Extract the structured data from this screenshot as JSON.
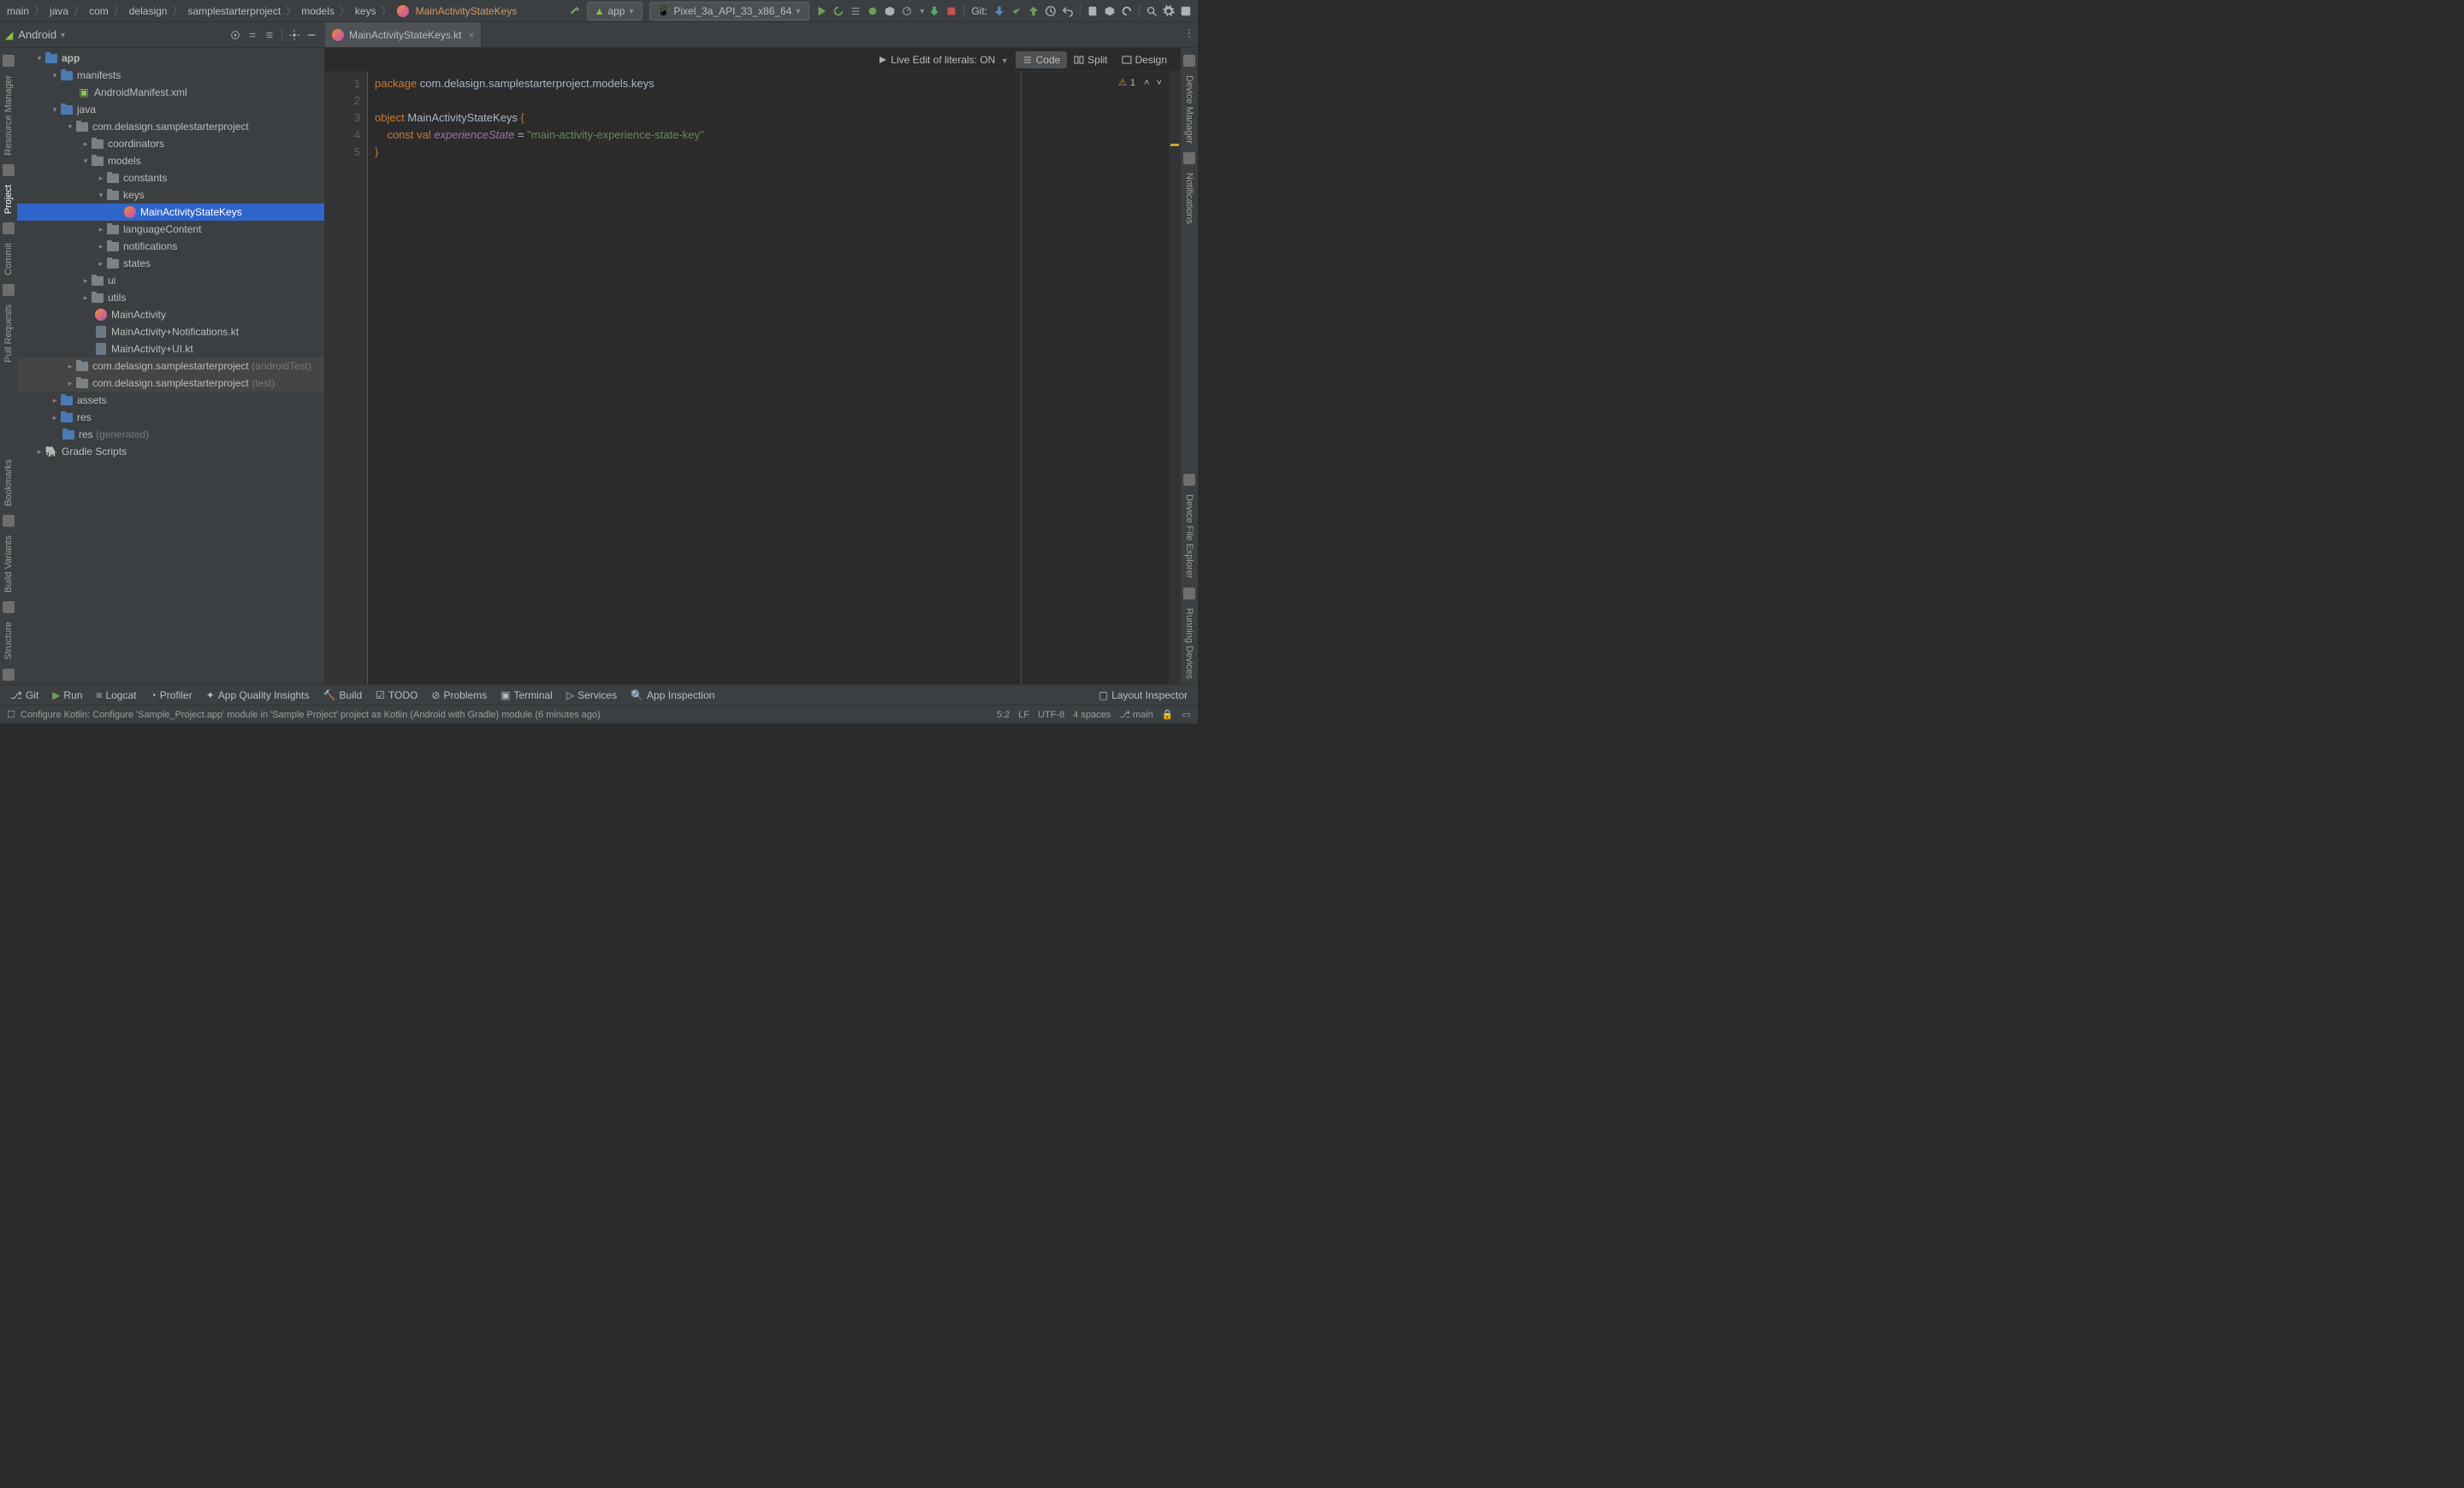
{
  "breadcrumbs": [
    "main",
    "java",
    "com",
    "delasign",
    "samplestarterproject",
    "models",
    "keys"
  ],
  "breadcrumb_file": "MainActivityStateKeys",
  "runConfig": "app",
  "device": "Pixel_3a_API_33_x86_64",
  "gitLabel": "Git:",
  "tabs": {
    "file": "MainActivityStateKeys.kt"
  },
  "sidebar": {
    "title": "Android",
    "tree": {
      "app": "app",
      "manifests": "manifests",
      "manifest_file": "AndroidManifest.xml",
      "java": "java",
      "pkg": "com.delasign.samplestarterproject",
      "coordinators": "coordinators",
      "models": "models",
      "constants": "constants",
      "keys": "keys",
      "selected": "MainActivityStateKeys",
      "languageContent": "languageContent",
      "notifications": "notifications",
      "states": "states",
      "ui": "ui",
      "utils": "utils",
      "mainActivity": "MainActivity",
      "mainNotif": "MainActivity+Notifications.kt",
      "mainUI": "MainActivity+UI.kt",
      "pkgAndroidTest": "com.delasign.samplestarterproject",
      "androidTest": "(androidTest)",
      "pkgTest": "com.delasign.samplestarterproject",
      "test": "(test)",
      "assets": "assets",
      "res": "res",
      "resGen": "res",
      "generated": "(generated)",
      "gradle": "Gradle Scripts"
    }
  },
  "editor": {
    "liveEdit": "Live Edit of literals: ON",
    "viewCode": "Code",
    "viewSplit": "Split",
    "viewDesign": "Design",
    "warnCount": "1",
    "lines": {
      "l1_kw": "package",
      "l1_rest": " com.delasign.samplestarterproject.models.keys",
      "l3_kw": "object",
      "l3_name": " MainActivityStateKeys ",
      "l3_brace": "{",
      "l4_indent": "    ",
      "l4_const": "const",
      "l4_val": " val",
      "l4_name": " experienceState",
      "l4_eq": " = ",
      "l4_str": "\"main-activity-experience-state-key\"",
      "l5": "}"
    },
    "lineNums": [
      "1",
      "2",
      "3",
      "4",
      "5"
    ]
  },
  "leftTools": [
    "Resource Manager",
    "Project",
    "Commit",
    "Pull Requests",
    "Bookmarks",
    "Build Variants",
    "Structure"
  ],
  "rightTools": [
    "Device Manager",
    "Notifications",
    "Device File Explorer",
    "Running Devices"
  ],
  "bottom": {
    "git": "Git",
    "run": "Run",
    "logcat": "Logcat",
    "profiler": "Profiler",
    "appq": "App Quality Insights",
    "build": "Build",
    "todo": "TODO",
    "problems": "Problems",
    "terminal": "Terminal",
    "services": "Services",
    "appinsp": "App Inspection",
    "layoutinsp": "Layout Inspector"
  },
  "status": {
    "msg": "Configure Kotlin: Configure 'Sample_Project.app' module in 'Sample Project' project as Kotlin (Android with Gradle) module (6 minutes ago)",
    "pos": "5:2",
    "enc1": "LF",
    "enc2": "UTF-8",
    "indent": "4 spaces",
    "branch": "main"
  }
}
